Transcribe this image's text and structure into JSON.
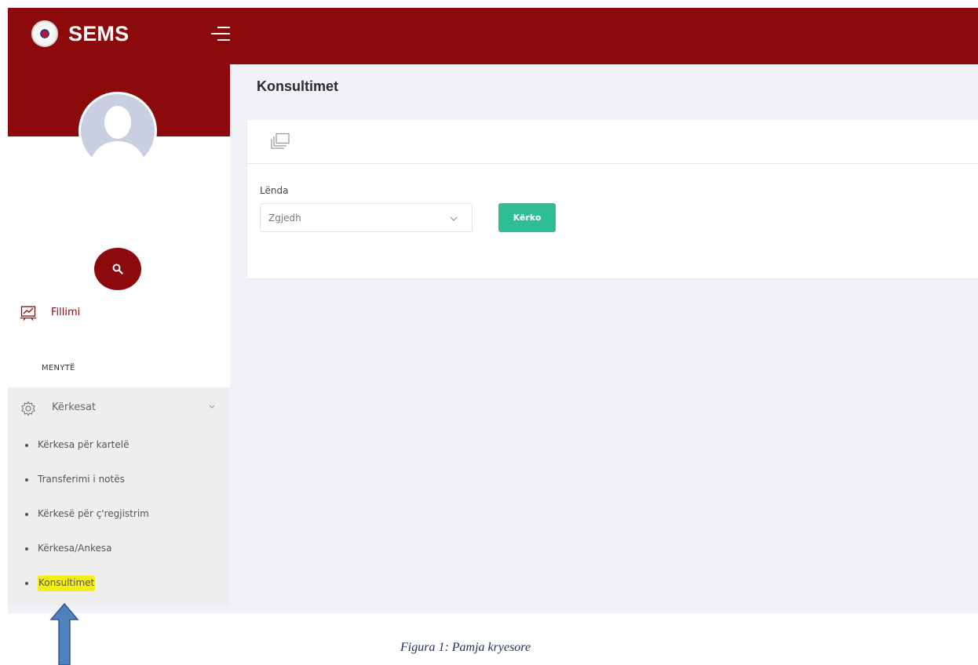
{
  "app": {
    "brand": "SEMS"
  },
  "sidebar": {
    "home_label": "Fillimi",
    "menu_heading": "MENYTË",
    "parent_item": {
      "label": "Kërkesat",
      "expanded": true
    },
    "submenu": [
      {
        "label": "Kërkesa për kartelë"
      },
      {
        "label": "Transferimi i notës"
      },
      {
        "label": "Kërkesë për ç'regjistrim"
      },
      {
        "label": "Kërkesa/Ankesa"
      },
      {
        "label": "Konsultimet",
        "highlighted": true
      }
    ]
  },
  "main": {
    "page_title": "Konsultimet",
    "form": {
      "field_label": "Lënda",
      "select_value": "Zgjedh",
      "submit_label": "Kërko"
    }
  },
  "annotation": {
    "caption": "Figura 1:  Pamja kryesore"
  },
  "icons": {
    "hamburger": "menu-icon",
    "avatar": "user-placeholder-icon",
    "search": "search-icon",
    "home": "presentation-chart-icon",
    "parent": "gear-icon",
    "card": "windows-stack-icon"
  },
  "colors": {
    "brand": "#8c0a0c",
    "accent_button": "#2fbd93",
    "highlight": "#f6ee12",
    "background": "#f1f2f7",
    "submenu_bg": "#eeeeee"
  }
}
